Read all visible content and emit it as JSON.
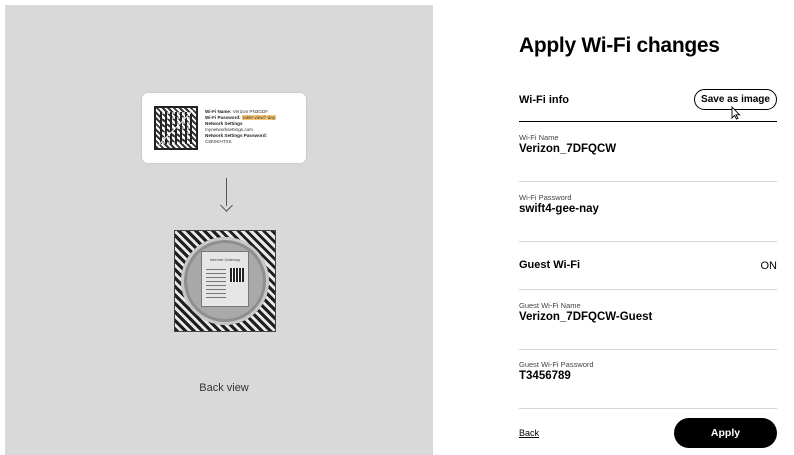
{
  "illustration": {
    "label_card": {
      "wifi_name_key": "Wi-Fi Name:",
      "wifi_name_val": "Verizon PN3GDF",
      "wifi_password_key": "Wi-Fi Password:",
      "wifi_password_val": "table-view7-day",
      "network_settings_key": "Network Settings",
      "network_settings_val": "mynetworksettings.com",
      "network_password_key": "Network Settings Password:",
      "network_password_val": "C8K0KHTXK"
    },
    "router_title": "Internet Gateway",
    "caption": "Back view"
  },
  "panel": {
    "title": "Apply Wi-Fi changes",
    "section_title": "Wi-Fi info",
    "save_button": "Save as image",
    "wifi_name_label": "Wi-Fi Name",
    "wifi_name": "Verizon_7DFQCW",
    "wifi_password_label": "Wi-Fi Password",
    "wifi_password": "swift4-gee-nay",
    "guest_title": "Guest Wi-Fi",
    "guest_state": "ON",
    "guest_name_label": "Guest Wi-Fi Name",
    "guest_name": "Verizon_7DFQCW-Guest",
    "guest_password_label": "Guest Wi-Fi Password",
    "guest_password": "T3456789",
    "back_link": "Back",
    "apply_button": "Apply"
  }
}
